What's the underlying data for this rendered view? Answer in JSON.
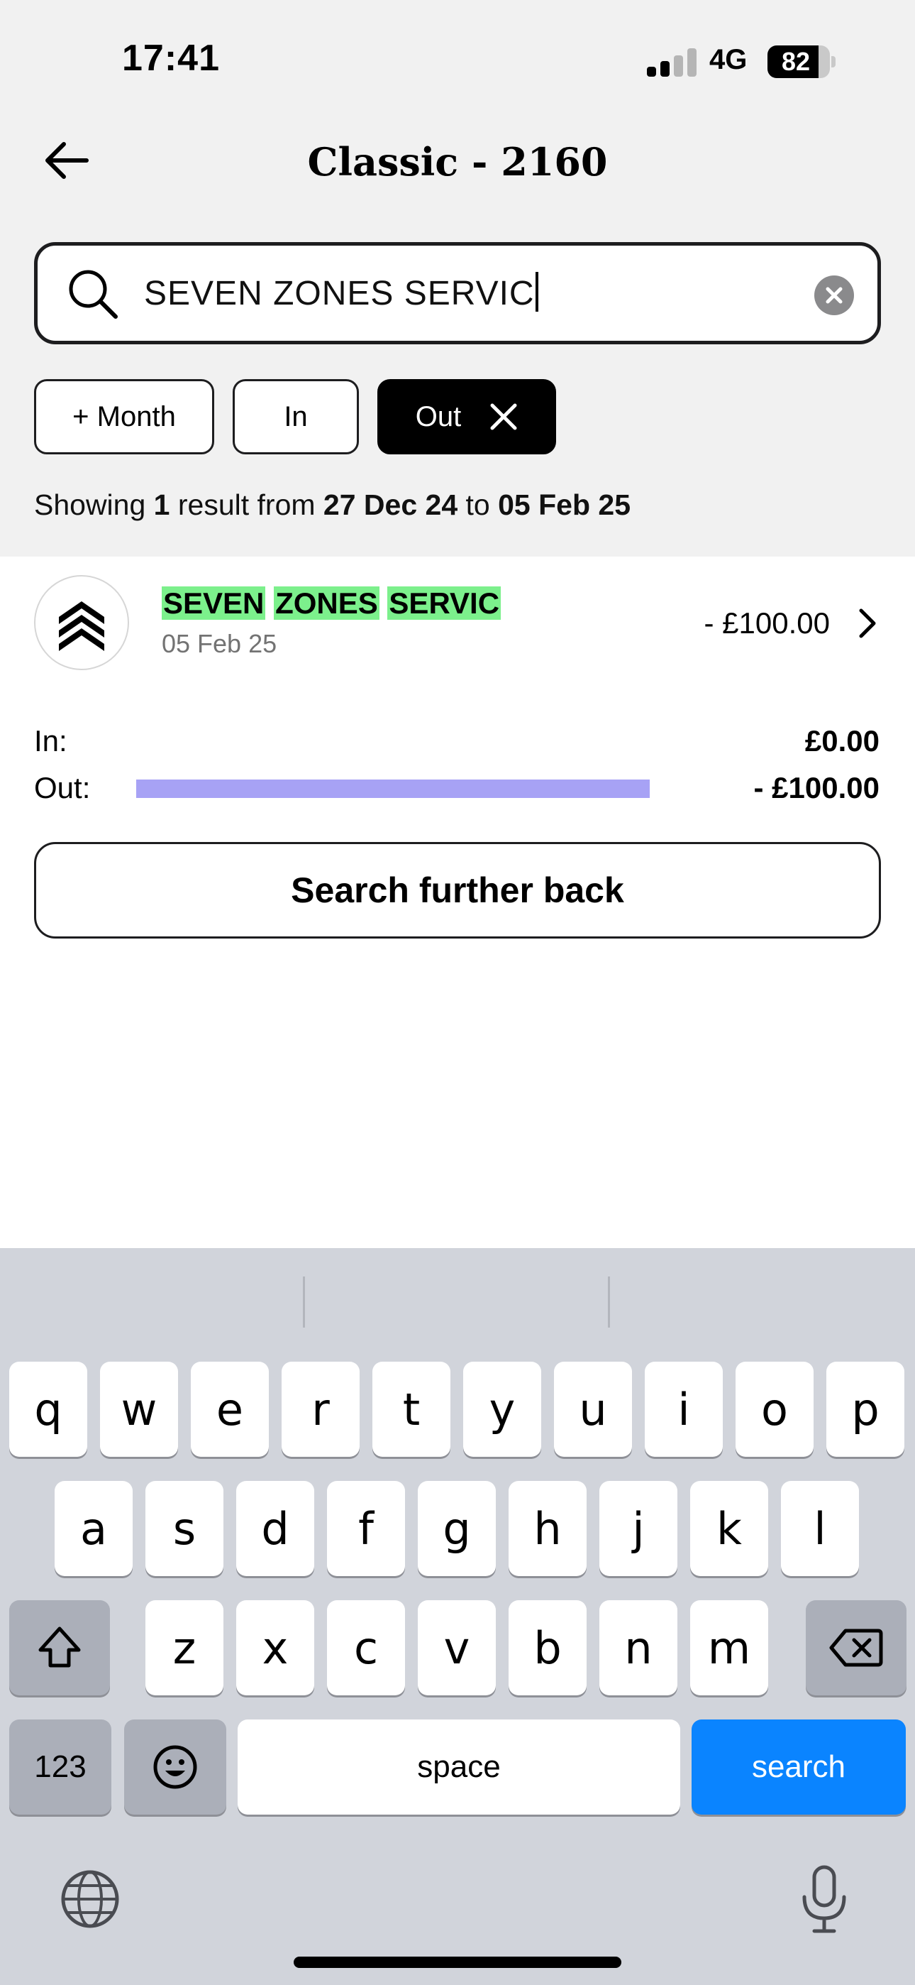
{
  "status_bar": {
    "time": "17:41",
    "network": "4G",
    "battery": "82",
    "battery_level": 0.82
  },
  "header": {
    "title": "Classic - 2160",
    "back_icon": "arrow-left-icon"
  },
  "search": {
    "value": "SEVEN ZONES SERVIC"
  },
  "filters": {
    "month": "+ Month",
    "in": "In",
    "out": "Out"
  },
  "summary": {
    "prefix": "Showing ",
    "count": "1",
    "mid": " result from ",
    "from": "27 Dec 24",
    "to_word": " to ",
    "to": "05 Feb 25"
  },
  "transactions": [
    {
      "name_words": [
        "SEVEN",
        "ZONES",
        "SERVIC"
      ],
      "date": "05 Feb 25",
      "amount": "- £100.00"
    }
  ],
  "totals": {
    "in_label": "In:",
    "in_value": "£0.00",
    "out_label": "Out:",
    "out_value": "- £100.00",
    "out_bar_color": "#a7a2f5"
  },
  "further_button": "Search further back",
  "keyboard": {
    "row1": [
      "q",
      "w",
      "e",
      "r",
      "t",
      "y",
      "u",
      "i",
      "o",
      "p"
    ],
    "row2": [
      "a",
      "s",
      "d",
      "f",
      "g",
      "h",
      "j",
      "k",
      "l"
    ],
    "row3": [
      "z",
      "x",
      "c",
      "v",
      "b",
      "n",
      "m"
    ],
    "numbers_key": "123",
    "space_key": "space",
    "search_key": "search",
    "accent": "#0a84ff"
  }
}
